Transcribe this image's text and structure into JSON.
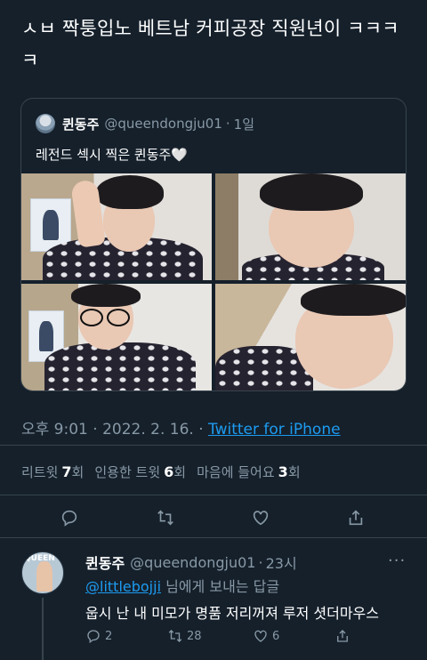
{
  "tweet": {
    "text": "ㅅㅂ 짝퉁입노 베트남 커피공장 직원년이 ㅋㅋㅋㅋ"
  },
  "quote": {
    "name": "퀸동주",
    "handle": "@queendongju01",
    "separator": "·",
    "time": "1일",
    "text": "레전드 섹시 찍은 퀸동주🤍"
  },
  "meta": {
    "time": "오후 9:01 · 2022. 2. 16. ·",
    "source": "Twitter for iPhone"
  },
  "counts": {
    "retweets_label": "리트윗",
    "retweets": "7",
    "retweets_unit": "회",
    "quotes_label": "인용한 트윗",
    "quotes": "6",
    "quotes_unit": "회",
    "likes_label": "마음에 들어요",
    "likes": "3",
    "likes_unit": "회"
  },
  "actions": {
    "icons": [
      "reply-icon",
      "retweet-icon",
      "like-icon",
      "share-icon"
    ]
  },
  "reply": {
    "name": "퀸동주",
    "handle": "@queendongju01",
    "separator": "·",
    "time": "23시",
    "more": "···",
    "mention": "@littlebojji",
    "replying_suffix": "님에게 보내는 답글",
    "text": "웁시 난 내 미모가 명품 저리꺼져 루저 셧더마우스",
    "avatar_text": "QUEEN",
    "reply_count": "2",
    "retweet_count": "28",
    "like_count": "6"
  },
  "colors": {
    "background": "#15202b",
    "text": "#ffffff",
    "secondary": "#8899a6",
    "link": "#1d9bf0",
    "border": "#38444d"
  }
}
